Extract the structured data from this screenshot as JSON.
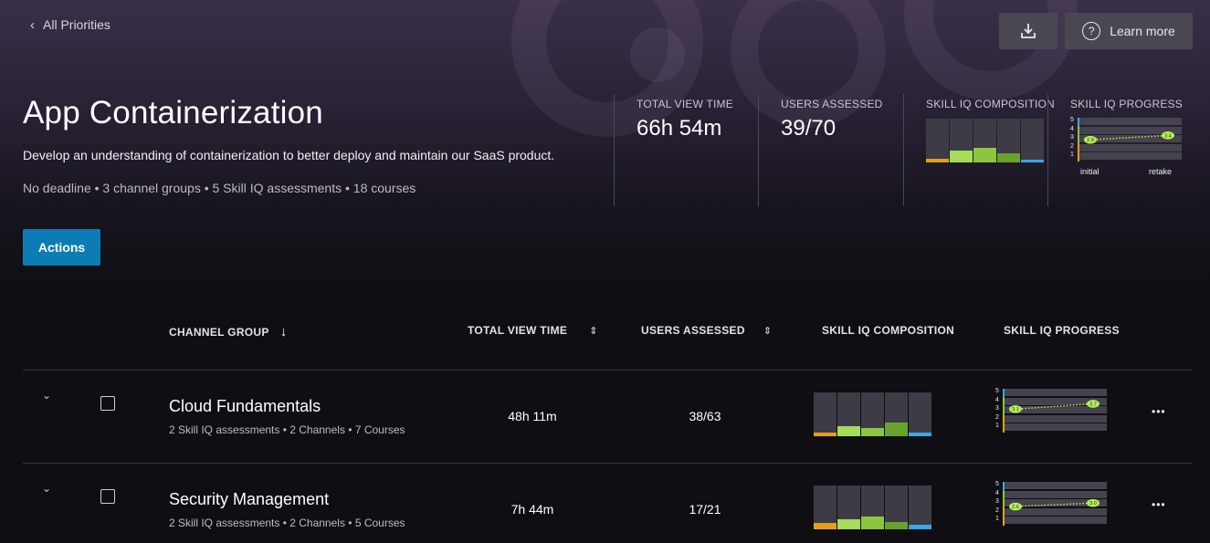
{
  "nav": {
    "back_label": "All Priorities"
  },
  "header": {
    "download_icon": "download-icon",
    "learn_more_label": "Learn more",
    "learn_more_icon": "question-circle-icon"
  },
  "priority": {
    "title": "App Containerization",
    "description": "Develop an understanding of containerization to better deploy and maintain our SaaS product.",
    "meta": "No deadline • 3 channel groups • 5 Skill IQ assessments • 18 courses"
  },
  "stats": {
    "total_view_time_label": "TOTAL VIEW TIME",
    "total_view_time_value": "66h 54m",
    "users_assessed_label": "USERS ASSESSED",
    "users_assessed_value": "39/70",
    "composition_label": "SKILL IQ COMPOSITION",
    "progress_label": "SKILL IQ PROGRESS",
    "composition": [
      0.08,
      0.28,
      0.33,
      0.2,
      0.06
    ],
    "progress": {
      "initial": "2.9",
      "retake": "3.4",
      "initial_level": 2.9,
      "retake_level": 3.4,
      "initial_caption": "initial",
      "retake_caption": "retake"
    }
  },
  "actions": {
    "label": "Actions"
  },
  "table": {
    "headers": {
      "channel_group": "CHANNEL GROUP",
      "total_view_time": "TOTAL VIEW TIME",
      "users_assessed": "USERS ASSESSED",
      "skill_iq_composition": "SKILL IQ COMPOSITION",
      "skill_iq_progress": "SKILL IQ PROGRESS"
    },
    "rows": [
      {
        "title": "Cloud Fundamentals",
        "meta": "2 Skill IQ assessments • 2 Channels • 7 Courses",
        "total_view_time": "48h 11m",
        "users_assessed": "38/63",
        "composition": [
          0.08,
          0.22,
          0.18,
          0.32,
          0.08
        ],
        "progress": {
          "initial": "3.1",
          "retake": "3.7",
          "initial_level": 3.1,
          "retake_level": 3.7
        },
        "more_label": "•••"
      },
      {
        "title": "Security Management",
        "meta": "2 Skill IQ assessments • 2 Channels • 5 Courses",
        "total_view_time": "7h 44m",
        "users_assessed": "17/21",
        "composition": [
          0.15,
          0.22,
          0.3,
          0.16,
          0.1
        ],
        "progress": {
          "initial": "2.6",
          "retake": "3.0",
          "initial_level": 2.6,
          "retake_level": 3.0
        },
        "more_label": "•••"
      }
    ]
  },
  "colors": {
    "novice": "#e3a018",
    "proficient_light": "#a6dc5a",
    "proficient": "#8cc63e",
    "proficient_dark": "#69a22c",
    "expert": "#38a9e6",
    "accent": "#0c7cb5",
    "progress_dot": "#b6f05a"
  },
  "progress_scale_labels": [
    "5",
    "4",
    "3",
    "2",
    "1"
  ]
}
